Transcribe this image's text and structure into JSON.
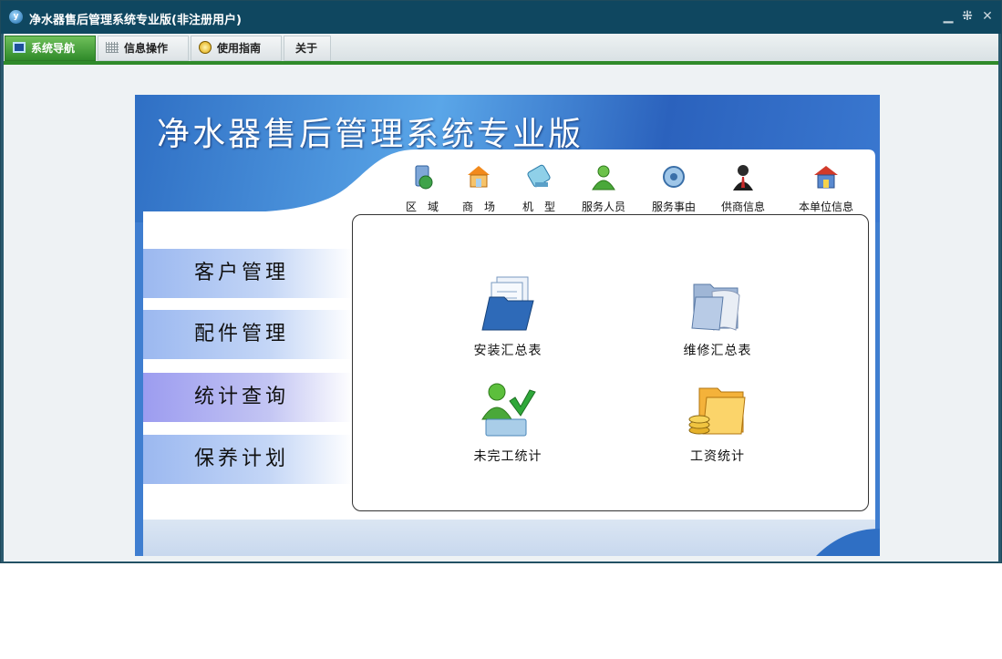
{
  "window": {
    "title": "净水器售后管理系统专业版(非注册用户)",
    "app_icon_letter": "y"
  },
  "menubar": {
    "tabs": [
      {
        "label": "系统导航",
        "icon": "monitor-icon",
        "active": true
      },
      {
        "label": "信息操作",
        "icon": "grid-icon",
        "active": false
      },
      {
        "label": "使用指南",
        "icon": "compass-icon",
        "active": false
      },
      {
        "label": "关于",
        "icon": "",
        "active": false
      }
    ]
  },
  "banner": {
    "title": "净水器售后管理系统专业版"
  },
  "shortcuts": [
    {
      "label": "区　域",
      "icon": "region-icon"
    },
    {
      "label": "商　场",
      "icon": "mall-icon"
    },
    {
      "label": "机　型",
      "icon": "model-icon"
    },
    {
      "label": "服务人员",
      "icon": "staff-icon"
    },
    {
      "label": "服务事由",
      "icon": "service-reason-icon"
    },
    {
      "label": "供商信息",
      "icon": "supplier-icon"
    },
    {
      "label": "本单位信息",
      "icon": "company-icon"
    }
  ],
  "left_menu": [
    {
      "label": "客户管理",
      "selected": false
    },
    {
      "label": "配件管理",
      "selected": false
    },
    {
      "label": "统计查询",
      "selected": true
    },
    {
      "label": "保养计划",
      "selected": false
    }
  ],
  "tiles": [
    {
      "label": "安装汇总表",
      "icon": "install-summary-icon"
    },
    {
      "label": "维修汇总表",
      "icon": "repair-summary-icon"
    },
    {
      "label": "未完工统计",
      "icon": "unfinished-stats-icon"
    },
    {
      "label": "工资统计",
      "icon": "salary-stats-icon"
    }
  ],
  "colors": {
    "titlebar": "#0f4760",
    "accent_green": "#2f8a2a",
    "banner_blue": "#3f7ed0"
  }
}
